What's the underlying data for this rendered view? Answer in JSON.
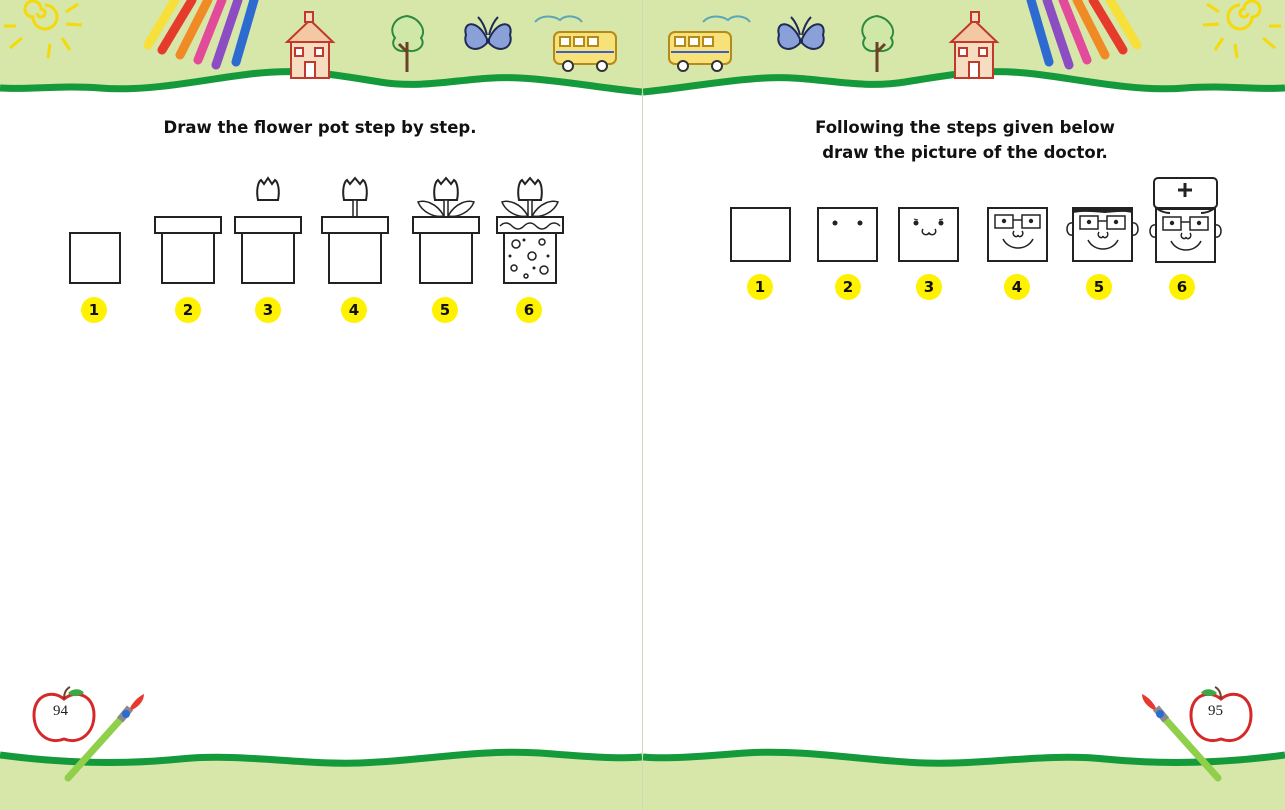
{
  "left_page": {
    "title": "Draw the flower pot step by step.",
    "steps": [
      "1",
      "2",
      "3",
      "4",
      "5",
      "6"
    ],
    "page_number": "94"
  },
  "right_page": {
    "title_line1": "Following the steps given below",
    "title_line2": "draw the picture of the doctor.",
    "steps": [
      "1",
      "2",
      "3",
      "4",
      "5",
      "6"
    ],
    "page_number": "95"
  },
  "colors": {
    "band_green": "#d7e6a9",
    "wave_green": "#149a3a",
    "badge_yellow": "#fff200"
  },
  "icons": [
    "sun-icon",
    "crayons-icon",
    "school-house-icon",
    "tree-icon",
    "butterfly-icon",
    "school-bus-icon",
    "cloud-icon",
    "apple-icon",
    "paintbrush-icon"
  ]
}
